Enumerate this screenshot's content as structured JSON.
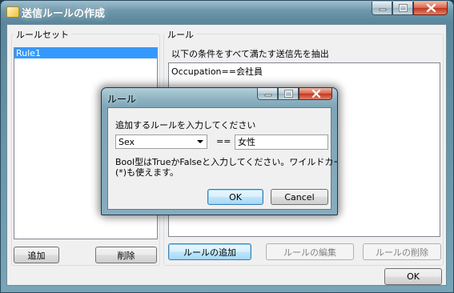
{
  "window": {
    "title": "送信ルールの作成",
    "ok_label": "OK"
  },
  "ruleset": {
    "group_label": "ルールセット",
    "items": [
      {
        "label": "Rule1",
        "selected": true
      }
    ],
    "add_label": "追加",
    "delete_label": "削除"
  },
  "rule": {
    "group_label": "ルール",
    "description": "以下の条件をすべて満たす送信先を抽出",
    "conditions": [
      "Occupation==会社員"
    ],
    "add_rule_label": "ルールの追加",
    "edit_rule_label": "ルールの編集",
    "delete_rule_label": "ルールの削除"
  },
  "dialog": {
    "title": "ルール",
    "prompt": "追加するルールを入力してください",
    "field_value": "Sex",
    "operator": "==",
    "value": "女性",
    "hint_line1": "Bool型はTrueかFalseと入力してください。ワイルドカード",
    "hint_line2": "(*)も使えます。",
    "ok_label": "OK",
    "cancel_label": "Cancel"
  },
  "colors": {
    "selection": "#3399ff",
    "title_glass": "#6f98ab"
  }
}
